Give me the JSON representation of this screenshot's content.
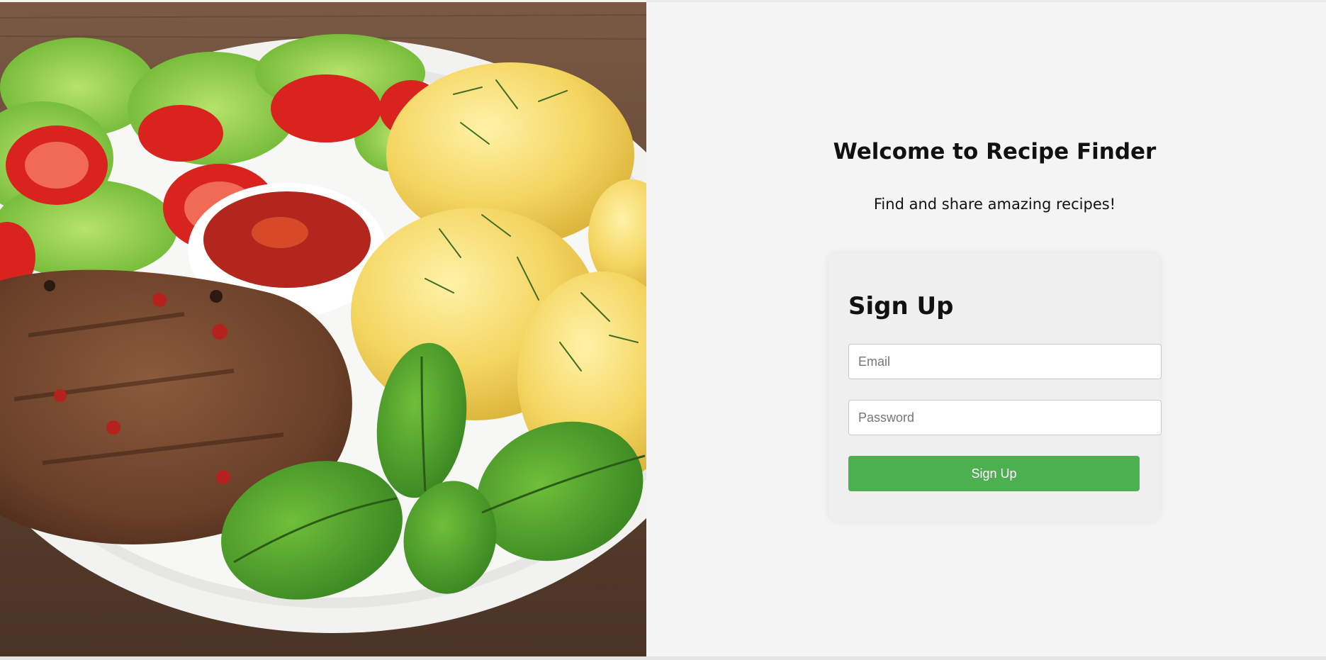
{
  "hero": {
    "image_subject": "grilled steak with salad, tomatoes, ketchup, boiled potatoes with dill and basil on a white plate"
  },
  "header": {
    "title": "Welcome to Recipe Finder",
    "tagline": "Find and share amazing recipes!"
  },
  "signup": {
    "title": "Sign Up",
    "email_placeholder": "Email",
    "password_placeholder": "Password",
    "submit_label": "Sign Up"
  },
  "colors": {
    "background": "#f4f4f4",
    "card": "#efefef",
    "accent_button": "#4caf50"
  }
}
